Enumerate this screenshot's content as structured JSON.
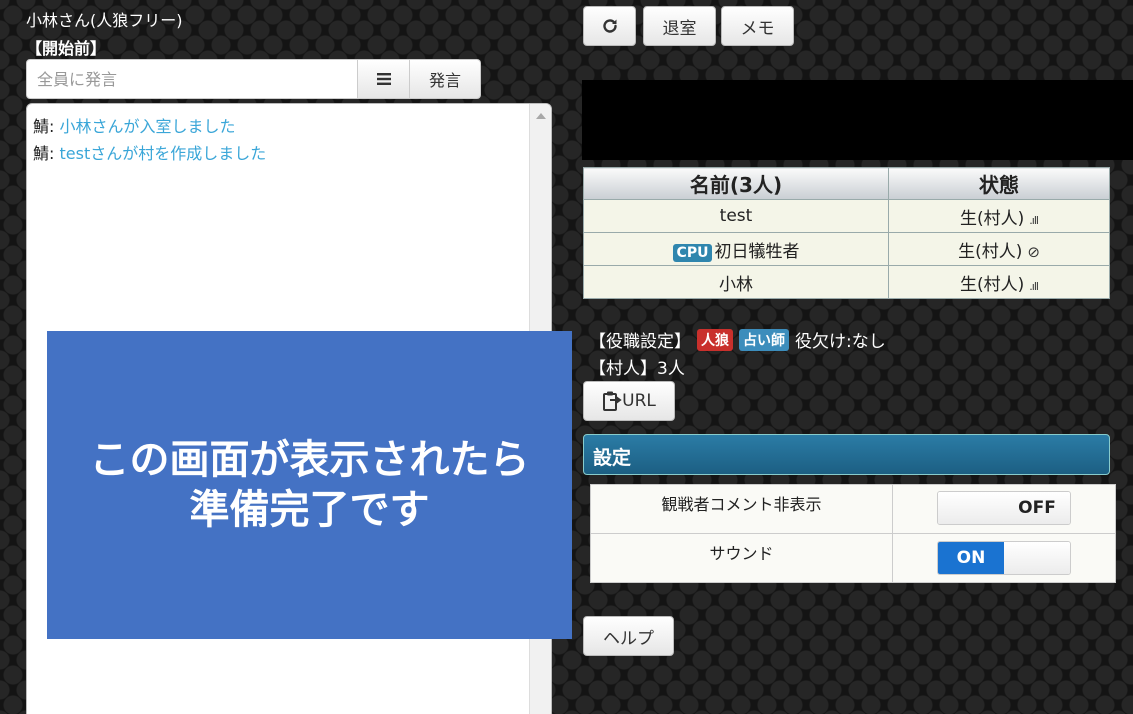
{
  "room": {
    "title": "小林さん(人狼フリー)",
    "status": "【開始前】"
  },
  "chat": {
    "placeholder": "全員に発言",
    "menu_icon": "list-icon",
    "speak_label": "発言",
    "lines": [
      {
        "who": "鯖",
        "sep": ":",
        "text": " 小林さんが入室しました"
      },
      {
        "who": "鯖",
        "sep": ":",
        "text": " testさんが村を作成しました"
      }
    ]
  },
  "overlay": {
    "line1": "この画面が表示されたら",
    "line2": "準備完了です"
  },
  "toolbar": {
    "reload_icon": "↻",
    "leave_label": "退室",
    "memo_label": "メモ"
  },
  "players": {
    "header_name": "名前(3人)",
    "header_status": "状態",
    "rows": [
      {
        "name": "test",
        "badge": "",
        "status": "生(村人)",
        "signal": ".ıll"
      },
      {
        "name": "初日犠牲者",
        "badge": "CPU",
        "status": "生(村人)",
        "signal": "⊘"
      },
      {
        "name": "小林",
        "badge": "",
        "status": "生(村人)",
        "signal": ".ıll"
      }
    ]
  },
  "roles": {
    "label": "【役職設定】",
    "wolf": "人狼",
    "seer": "占い師",
    "missing": "役欠け:なし",
    "villagers": "【村人】3人"
  },
  "url_button": {
    "label": "URL",
    "icon": "clipboard-icon"
  },
  "settings": {
    "title": "設定",
    "items": [
      {
        "label": "観戦者コメント非表示",
        "state": "OFF"
      },
      {
        "label": "サウンド",
        "state": "ON"
      }
    ]
  },
  "help": {
    "label": "ヘルプ"
  },
  "colors": {
    "overlay": "#4472c4",
    "chat_text": "#3aa6d8",
    "cpu_badge": "#2f86ae",
    "wolf_badge": "#c9302c",
    "seer_badge": "#3c8dbc",
    "toggle_on": "#1a73d1"
  }
}
